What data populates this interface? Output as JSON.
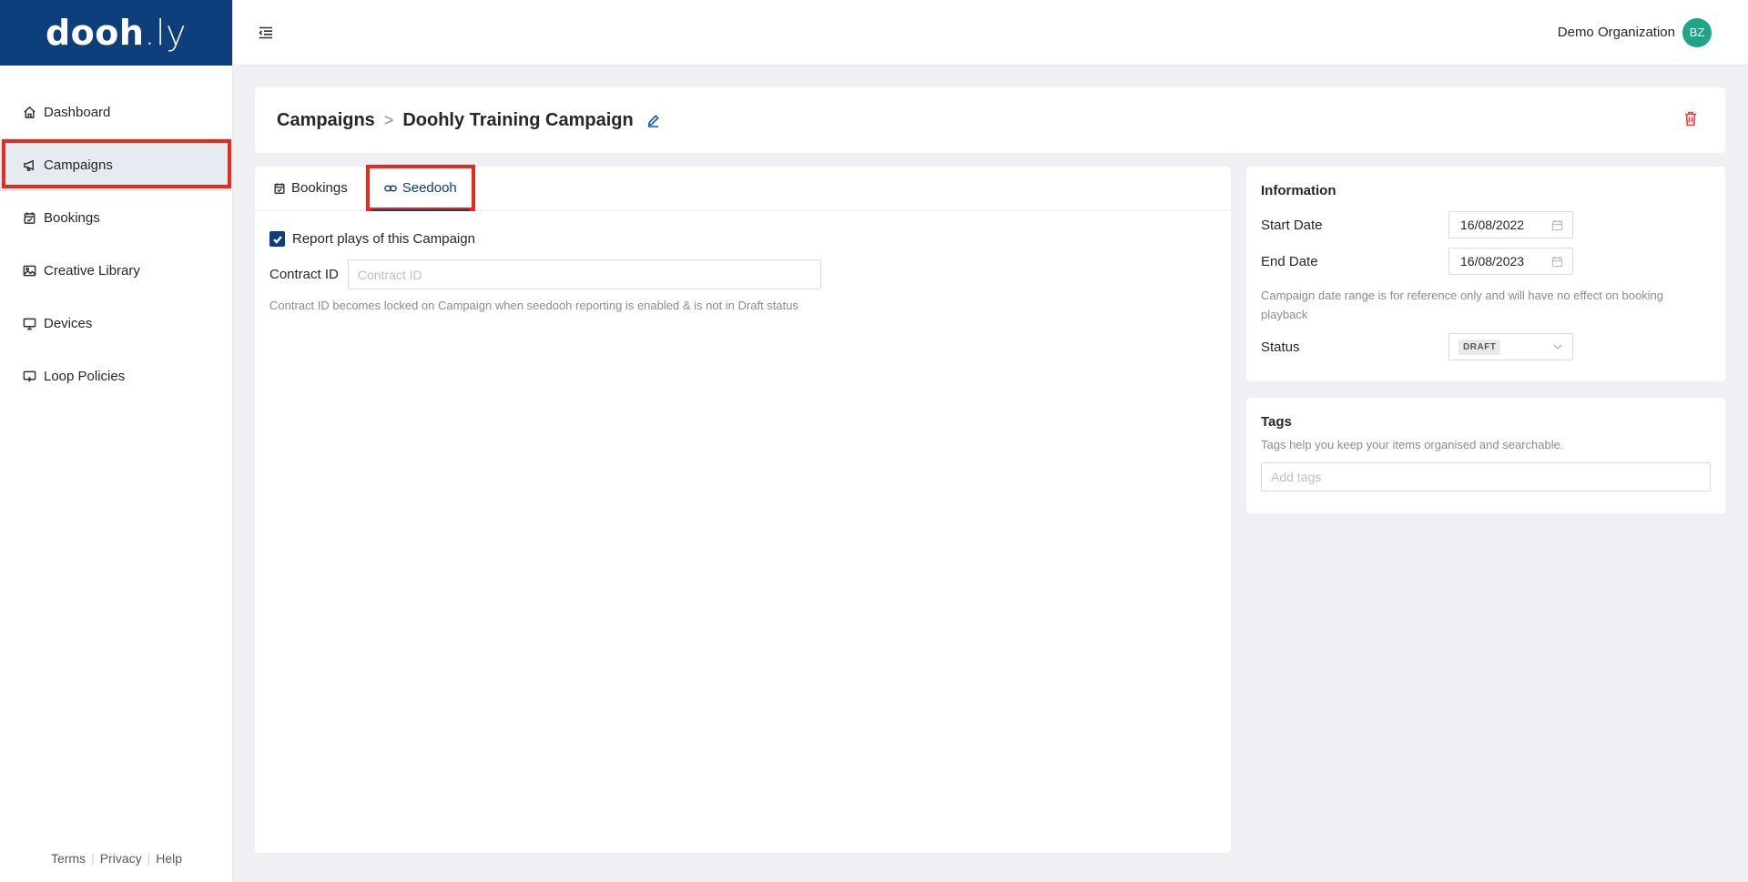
{
  "app": {
    "logo_main": "dooh",
    "logo_suffix": ".ly"
  },
  "sidebar": {
    "items": [
      {
        "label": "Dashboard",
        "icon": "home-icon"
      },
      {
        "label": "Campaigns",
        "icon": "megaphone-icon",
        "active": true
      },
      {
        "label": "Bookings",
        "icon": "calendar-check-icon"
      },
      {
        "label": "Creative Library",
        "icon": "image-icon"
      },
      {
        "label": "Devices",
        "icon": "monitor-icon"
      },
      {
        "label": "Loop Policies",
        "icon": "loop-icon"
      }
    ],
    "footer": {
      "terms": "Terms",
      "privacy": "Privacy",
      "help": "Help"
    }
  },
  "topbar": {
    "org_name": "Demo Organization",
    "avatar_initials": "BZ",
    "avatar_color": "#1ea588"
  },
  "header": {
    "breadcrumb_root": "Campaigns",
    "breadcrumb_sep": ">",
    "campaign_name": "Doohly Training Campaign"
  },
  "tabs": {
    "bookings_label": "Bookings",
    "seedooh_label": "Seedooh"
  },
  "seedooh": {
    "report_checkbox_label": "Report plays of this Campaign",
    "report_checked": true,
    "contract_label": "Contract ID",
    "contract_value": "",
    "contract_placeholder": "Contract ID",
    "hint": "Contract ID becomes locked on Campaign when seedooh reporting is enabled & is not in Draft status"
  },
  "information": {
    "title": "Information",
    "start_label": "Start Date",
    "start_value": "16/08/2022",
    "end_label": "End Date",
    "end_value": "16/08/2023",
    "note": "Campaign date range is for reference only and will have no effect on booking playback",
    "status_label": "Status",
    "status_value": "DRAFT"
  },
  "tags": {
    "title": "Tags",
    "description": "Tags help you keep your items organised and searchable.",
    "placeholder": "Add tags"
  },
  "colors": {
    "brand": "#0d3f7c",
    "highlight": "#e32b1e",
    "delete": "#e34234"
  }
}
